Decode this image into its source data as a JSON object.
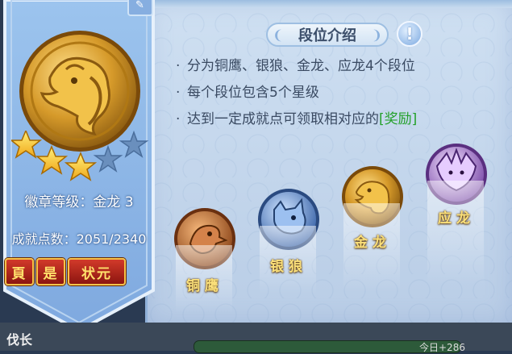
{
  "panel": {
    "title": "段位介绍",
    "bullets": [
      {
        "text": "分为铜鹰、银狼、金龙、应龙4个段位",
        "highlight": ""
      },
      {
        "text": "每个段位包含5个星级",
        "highlight": ""
      },
      {
        "text": "达到一定成就点可领取相对应的",
        "highlight": "[奖励]"
      }
    ]
  },
  "badge": {
    "rank": "金龙",
    "stars_filled": 3,
    "stars_total": 5,
    "level_label": "徽章等级：金龙 3",
    "points_label": "成就点数：2051/2340"
  },
  "tags": [
    "頁",
    "是",
    "状元"
  ],
  "ranks": [
    {
      "name": "铜鹰",
      "color": "#c9763a",
      "icon": "eagle-icon"
    },
    {
      "name": "银狼",
      "color": "#5b86c8",
      "icon": "wolf-icon"
    },
    {
      "name": "金龙",
      "color": "#d9a02a",
      "icon": "dragon-icon"
    },
    {
      "name": "应龙",
      "color": "#a87bd0",
      "icon": "winged-dragon-icon"
    }
  ],
  "bottom": {
    "label": "伐长",
    "right_text": "今日+286"
  }
}
